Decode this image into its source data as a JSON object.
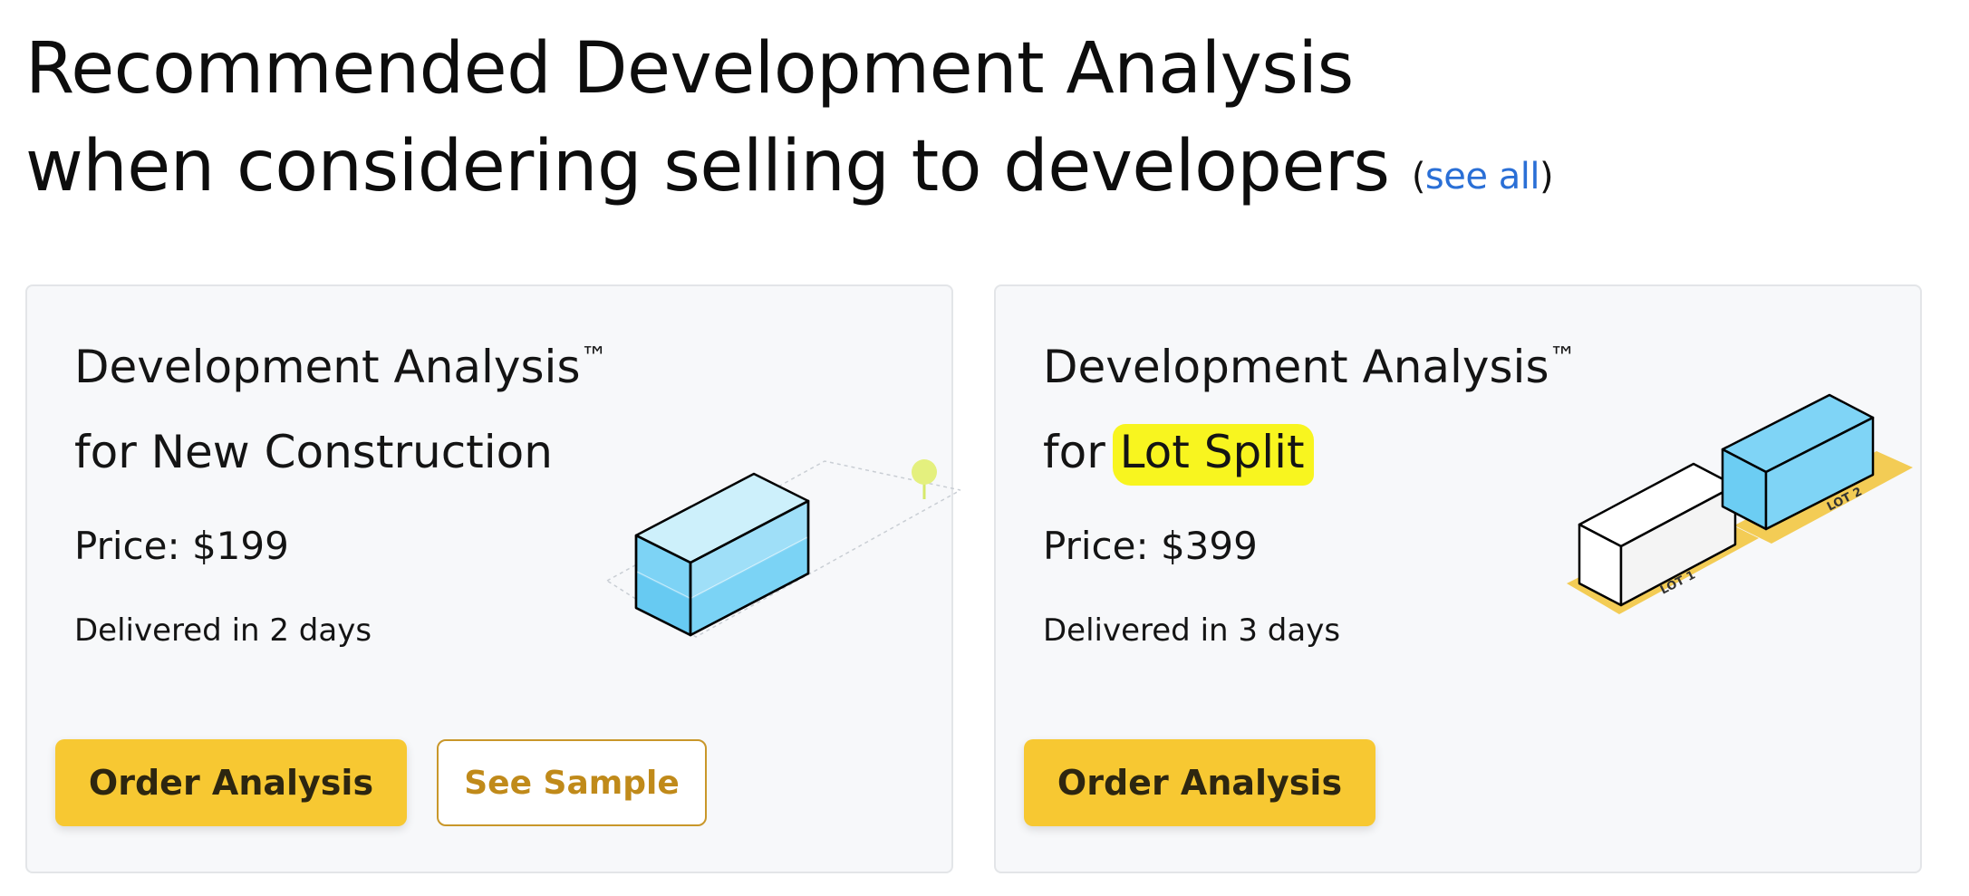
{
  "header": {
    "line1": "Recommended Development Analysis",
    "line2_prefix": "when considering selling to ",
    "highlight": "developers",
    "paren_open": "(",
    "see_all": "see all",
    "paren_close": ")"
  },
  "cards": [
    {
      "title_line1": "Development Analysis",
      "trademark": "™",
      "title_line2": "for New Construction",
      "price": "Price: $199",
      "delivery": "Delivered in 2 days",
      "order_label": "Order Analysis",
      "sample_label": "See Sample",
      "illustration": "building-on-lot-icon"
    },
    {
      "title_line1": "Development Analysis",
      "trademark": "™",
      "title_line2_prefix": "for ",
      "title_line2_highlight": "Lot Split",
      "price": "Price: $399",
      "delivery": "Delivered in 3 days",
      "order_label": "Order Analysis",
      "illustration": "lot-split-icon",
      "lot_labels": [
        "LOT 1",
        "LOT 2"
      ]
    }
  ],
  "colors": {
    "highlight": "#f8f51f",
    "primary_button": "#f7c832",
    "outline_accent": "#c9972a",
    "link": "#2a6fd6",
    "building_blue": "#7dd3f5",
    "lot_yellow": "#f3cc55"
  }
}
